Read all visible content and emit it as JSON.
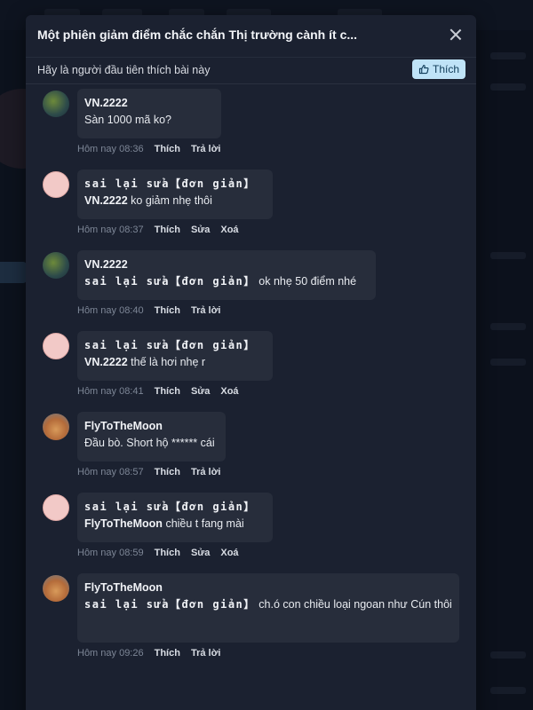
{
  "modal": {
    "title": "Một phiên giảm điểm chắc chắn Thị trường cành ít c...",
    "like_prompt": "Hãy là người đầu tiên thích bài này",
    "like_button": "Thích"
  },
  "comments": [
    {
      "author": "VN.2222",
      "avatar": "vn2222-avatar",
      "mention": "",
      "text": "Sàn 1000 mã ko?",
      "time": "Hôm nay 08:36",
      "actions": [
        "Thích",
        "Trả lời"
      ]
    },
    {
      "author": "sai lại sửa【đơn giản】",
      "avatar": "sai-avatar",
      "mention": "VN.2222",
      "text": "ko giảm nhẹ thôi",
      "time": "Hôm nay 08:37",
      "actions": [
        "Thích",
        "Sửa",
        "Xoá"
      ]
    },
    {
      "author": "VN.2222",
      "avatar": "vn2222-avatar",
      "mention": "sai lại sửa【đơn giản】",
      "text": "ok nhẹ 50 điểm nhé",
      "time": "Hôm nay 08:40",
      "actions": [
        "Thích",
        "Trả lời"
      ]
    },
    {
      "author": "sai lại sửa【đơn giản】",
      "avatar": "sai-avatar",
      "mention": "VN.2222",
      "text": "thế là hơi nhẹ r",
      "time": "Hôm nay 08:41",
      "actions": [
        "Thích",
        "Sửa",
        "Xoá"
      ]
    },
    {
      "author": "FlyToTheMoon",
      "avatar": "fly-avatar",
      "mention": "",
      "text": "Đầu bò. Short hộ ****** cái",
      "time": "Hôm nay 08:57",
      "actions": [
        "Thích",
        "Trả lời"
      ]
    },
    {
      "author": "sai lại sửa【đơn giản】",
      "avatar": "sai-avatar",
      "mention": "FlyToTheMoon",
      "text": "chiều t fang mài",
      "time": "Hôm nay 08:59",
      "actions": [
        "Thích",
        "Sửa",
        "Xoá"
      ]
    },
    {
      "author": "FlyToTheMoon",
      "avatar": "fly-avatar",
      "mention": "sai lại sửa【đơn giản】",
      "text": "ch.ó con chiều loại ngoan như Cún thôi",
      "time": "Hôm nay 09:26",
      "actions": [
        "Thích",
        "Trả lời"
      ]
    }
  ]
}
